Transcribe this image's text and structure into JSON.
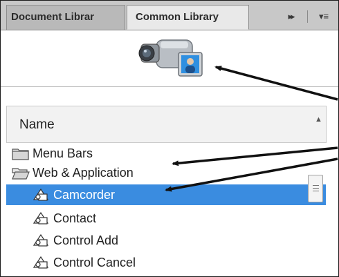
{
  "tabs": [
    {
      "label": "Document Librar",
      "active": false
    },
    {
      "label": "Common Library",
      "active": true
    }
  ],
  "tab_controls": {
    "collapse": "▸▸",
    "menu": "▾≡"
  },
  "list": {
    "column_header": "Name",
    "items": [
      {
        "label": "Menu Bars",
        "icon": "folder-closed-icon",
        "selected": false
      },
      {
        "label": "Web & Application",
        "icon": "folder-open-icon",
        "selected": false
      },
      {
        "label": "Camcorder",
        "icon": "symbol-icon",
        "selected": true
      },
      {
        "label": "Contact",
        "icon": "symbol-icon",
        "selected": false
      },
      {
        "label": "Control Add",
        "icon": "symbol-icon",
        "selected": false
      },
      {
        "label": "Control Cancel",
        "icon": "symbol-icon",
        "selected": false
      }
    ]
  },
  "colors": {
    "selection": "#3a8ce0",
    "tab_bar": "#c8c8c8",
    "active_tab": "#e9e9e9"
  }
}
